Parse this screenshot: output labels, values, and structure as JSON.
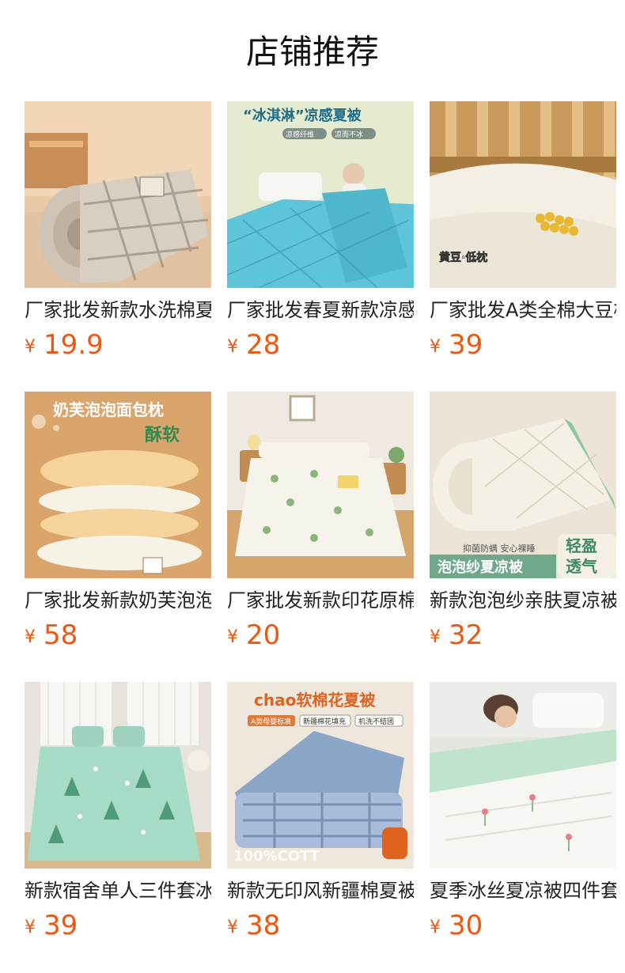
{
  "header": {
    "title": "店铺推荐"
  },
  "products": [
    {
      "name": "厂家批发新款水洗棉夏凉被",
      "currency": "¥",
      "price": "19.9",
      "image_text": []
    },
    {
      "name": "厂家批发春夏新款凉感夏被",
      "currency": "¥",
      "price": "28",
      "image_text": [
        "“冰淇淋”凉感夏被",
        "凉感纤维",
        "凉而不冰"
      ]
    },
    {
      "name": "厂家批发A类全棉大豆枕头",
      "currency": "¥",
      "price": "39",
      "image_text": [
        "黄豆·低枕"
      ]
    },
    {
      "name": "厂家批发新款奶芙泡泡枕头",
      "currency": "¥",
      "price": "58",
      "image_text": [
        "奶芙泡泡面包枕",
        "酥软"
      ]
    },
    {
      "name": "厂家批发新款印花原棉床单",
      "currency": "¥",
      "price": "20",
      "image_text": []
    },
    {
      "name": "新款泡泡纱亲肤夏凉被",
      "currency": "¥",
      "price": "32",
      "image_text": [
        "抑菌防螨 安心裸睡",
        "泡泡纱夏凉被",
        "轻盈",
        "透气"
      ]
    },
    {
      "name": "新款宿舍单人三件套冰丝凉席",
      "currency": "¥",
      "price": "39",
      "image_text": []
    },
    {
      "name": "新款无印风新疆棉夏被",
      "currency": "¥",
      "price": "38",
      "image_text": [
        "chao软棉花夏被",
        "A类母婴标准",
        "新疆棉花填充",
        "机洗不结团",
        "100%COTT"
      ]
    },
    {
      "name": "夏季冰丝夏凉被四件套",
      "currency": "¥",
      "price": "30",
      "image_text": []
    }
  ],
  "colors": {
    "price": "#f0560f",
    "title": "#111111"
  }
}
